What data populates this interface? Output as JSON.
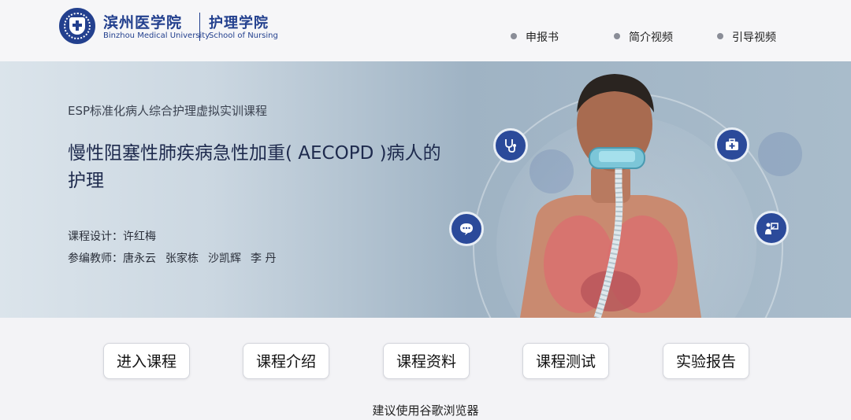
{
  "header": {
    "university_cn": "滨州医学院",
    "university_en": "Binzhou Medical University",
    "school_cn": "护理学院",
    "school_en": "School of Nursing",
    "nav": [
      {
        "label": "申报书"
      },
      {
        "label": "简介视频"
      },
      {
        "label": "引导视频"
      }
    ]
  },
  "banner": {
    "subtitle": "ESP标准化病人综合护理虚拟实训课程",
    "title": "慢性阻塞性肺疾病急性加重( AECOPD )病人的护理",
    "designer_label": "课程设计：",
    "designer": "许红梅",
    "teachers_label": "参编教师：",
    "teachers": [
      "唐永云",
      "张家栋",
      "沙凯辉",
      "李 丹"
    ]
  },
  "buttons": [
    {
      "label": "进入课程"
    },
    {
      "label": "课程介绍"
    },
    {
      "label": "课程资料"
    },
    {
      "label": "课程测试"
    },
    {
      "label": "实验报告"
    }
  ],
  "footer": {
    "browser_tip": "建议使用谷歌浏览器"
  },
  "colors": {
    "brand": "#23408e",
    "icon_bg": "#2b4a9a"
  },
  "icons": [
    "stethoscope-icon",
    "chat-icon",
    "first-aid-kit-icon",
    "presentation-icon"
  ]
}
